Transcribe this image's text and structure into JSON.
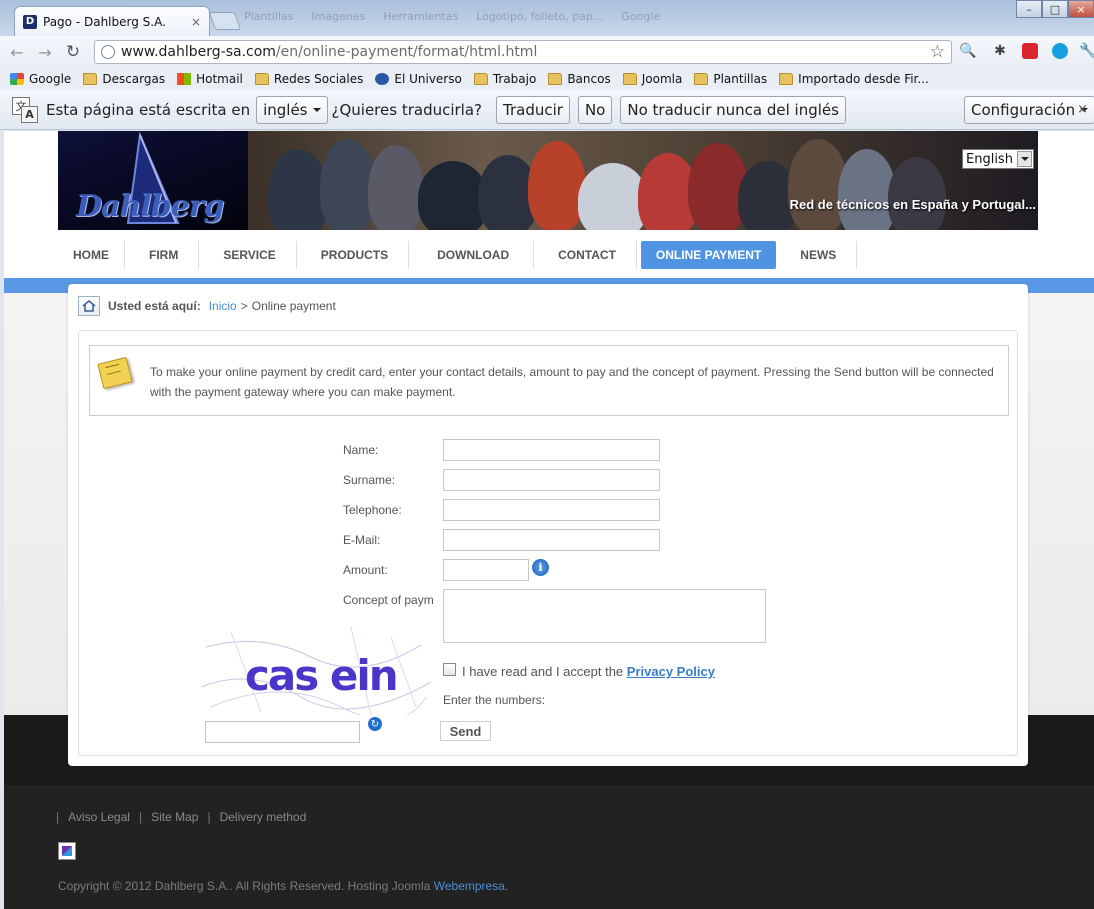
{
  "browser": {
    "tab_title": "Pago - Dahlberg S.A.",
    "tab_close": "×",
    "background_tabs": [
      "Plantillas",
      "Imagenes",
      "Herramientas",
      "Logotipo, folleto, pap...",
      "Google"
    ],
    "url_host": "www.dahlberg-sa.com",
    "url_path": "/en/online-payment/format/html.html",
    "bookmarks": [
      {
        "label": "Google",
        "icon": "google-icon"
      },
      {
        "label": "Descargas",
        "icon": "folder-icon"
      },
      {
        "label": "Hotmail",
        "icon": "windows-icon"
      },
      {
        "label": "Redes Sociales",
        "icon": "folder-icon"
      },
      {
        "label": "El Universo",
        "icon": "eluniverso-icon"
      },
      {
        "label": "Trabajo",
        "icon": "folder-icon"
      },
      {
        "label": "Bancos",
        "icon": "folder-icon"
      },
      {
        "label": "Joomla",
        "icon": "folder-icon"
      },
      {
        "label": "Plantillas",
        "icon": "folder-icon"
      },
      {
        "label": "Importado desde Fir...",
        "icon": "folder-icon"
      }
    ],
    "translate_bar": {
      "prefix": "Esta página está escrita en",
      "language": "inglés",
      "question": "¿Quieres traducirla?",
      "translate_btn": "Traducir",
      "no_btn": "No",
      "never_btn": "No traducir nunca del inglés",
      "settings_btn": "Configuración"
    }
  },
  "site": {
    "logo": "Dahlberg",
    "language": "English",
    "slogan": "Red de técnicos en España y Portugal...",
    "menu": [
      "HOME",
      "FIRM",
      "SERVICE",
      "PRODUCTS",
      "DOWNLOAD",
      "CONTACT",
      "ONLINE PAYMENT",
      "NEWS"
    ],
    "active_menu": "ONLINE PAYMENT"
  },
  "breadcrumb": {
    "label": "Usted está aquí:",
    "home": "Inicio",
    "separator": ">",
    "current": "Online payment"
  },
  "notice": "To make your online payment by credit card, enter your contact details, amount to pay and the concept of payment. Pressing the Send button will be connected with the payment gateway where you can make payment.",
  "form": {
    "name_label": "Name:",
    "surname_label": "Surname:",
    "telephone_label": "Telephone:",
    "email_label": "E-Mail:",
    "amount_label": "Amount:",
    "concept_label": "Concept of paym",
    "privacy_text": "I have read and I accept the",
    "privacy_link": "Privacy Policy",
    "enter_numbers": "Enter the numbers:",
    "captcha": "cas ein",
    "send": "Send"
  },
  "footer": {
    "links": [
      "Aviso Legal",
      "Site Map",
      "Delivery method"
    ],
    "copyright": "Copyright © 2012 Dahlberg S.A.. All Rights Reserved. Hosting Joomla",
    "hosting_link": "Webempresa",
    "period": "."
  },
  "colors": {
    "accent": "#4f94e3",
    "link": "#4a8fd8",
    "dark_footer": "#222222"
  }
}
